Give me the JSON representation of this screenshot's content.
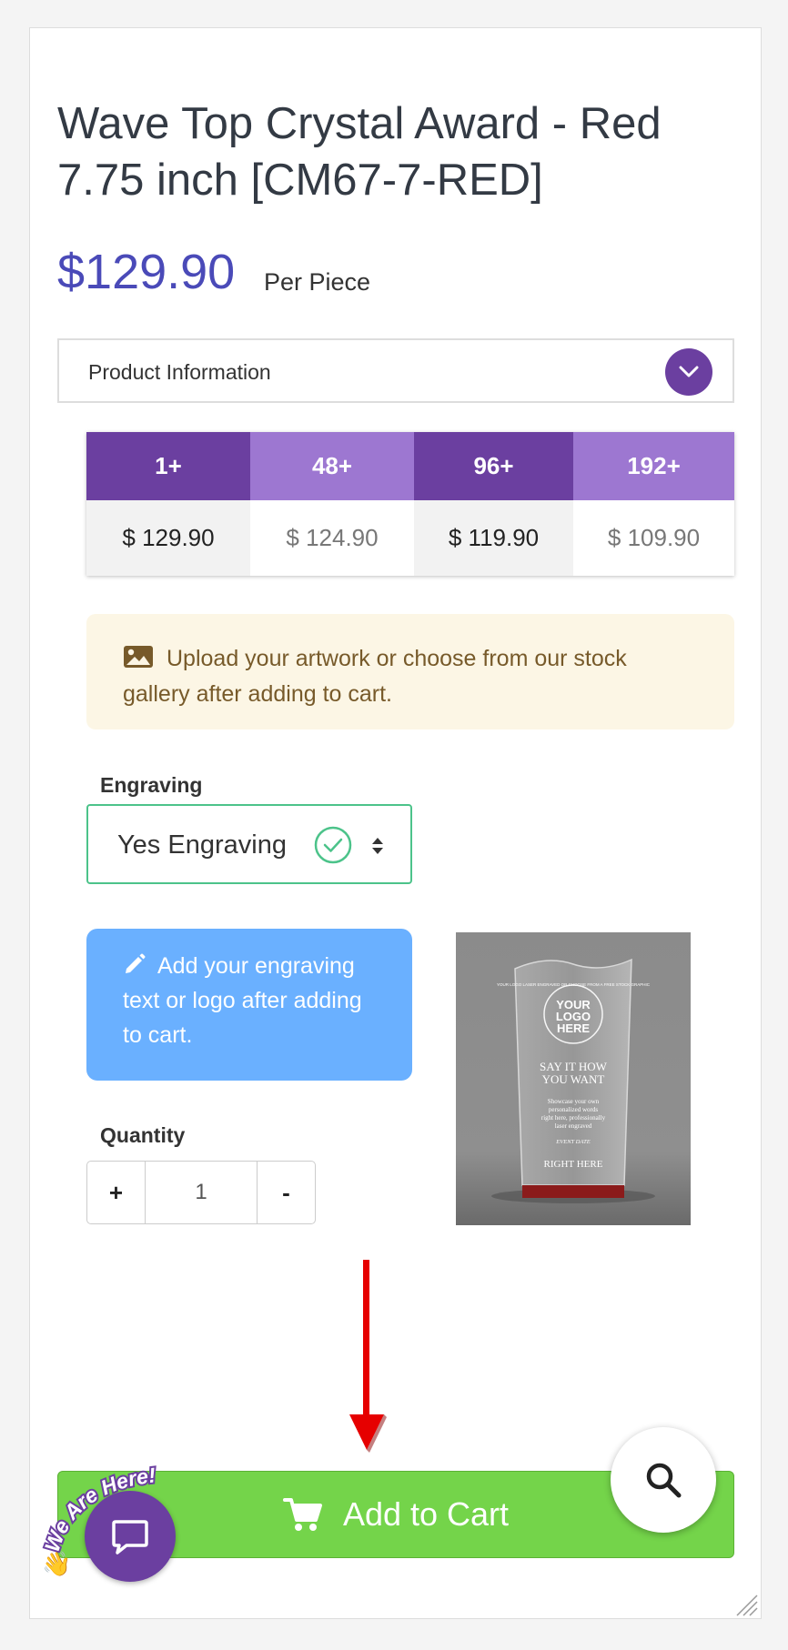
{
  "product": {
    "title": "Wave Top Crystal Award - Red 7.75 inch [CM67-7-RED]",
    "price": "$129.90",
    "price_unit": "Per Piece"
  },
  "accordion": {
    "label": "Product Information",
    "toggle_icon": "chevron-down-icon"
  },
  "pricing_tiers": [
    {
      "qty": "1+",
      "price": "$ 129.90"
    },
    {
      "qty": "48+",
      "price": "$ 124.90"
    },
    {
      "qty": "96+",
      "price": "$ 119.90"
    },
    {
      "qty": "192+",
      "price": "$ 109.90"
    }
  ],
  "upload_notice": {
    "icon": "image-icon",
    "text": "Upload your artwork or choose from our stock gallery after adding to cart."
  },
  "engraving": {
    "label": "Engraving",
    "value": "Yes Engraving"
  },
  "engraving_note": {
    "icon": "pencil-icon",
    "text": "Add your engraving text or logo after adding to cart."
  },
  "product_image": {
    "logo_ring": "YOUR LOGO LASER ENGRAVED OR CHOOSE FROM A FREE STOCK GRAPHIC",
    "logo_line1": "YOUR",
    "logo_line2": "LOGO",
    "logo_line3": "HERE",
    "headline1": "SAY IT HOW",
    "headline2": "YOU WANT",
    "body1": "Showcase your own",
    "body2": "personalized words",
    "body3": "right here, professionally",
    "body4": "laser engraved",
    "event": "EVENT DATE",
    "footer": "RIGHT HERE"
  },
  "quantity": {
    "label": "Quantity",
    "plus": "+",
    "value": "1",
    "minus": "-"
  },
  "cart": {
    "label": "Add to Cart",
    "icon": "cart-icon"
  },
  "chat": {
    "badge_text": "We Are Here!",
    "icon": "chat-bubble-icon"
  },
  "search": {
    "icon": "search-icon"
  },
  "colors": {
    "brand_purple": "#6b3fa0",
    "tier_light": "#9d77d1",
    "price_blue": "#4a4ab8",
    "cart_green": "#74d44a",
    "note_blue": "#6ab0ff",
    "arrow_red": "#e60000"
  }
}
